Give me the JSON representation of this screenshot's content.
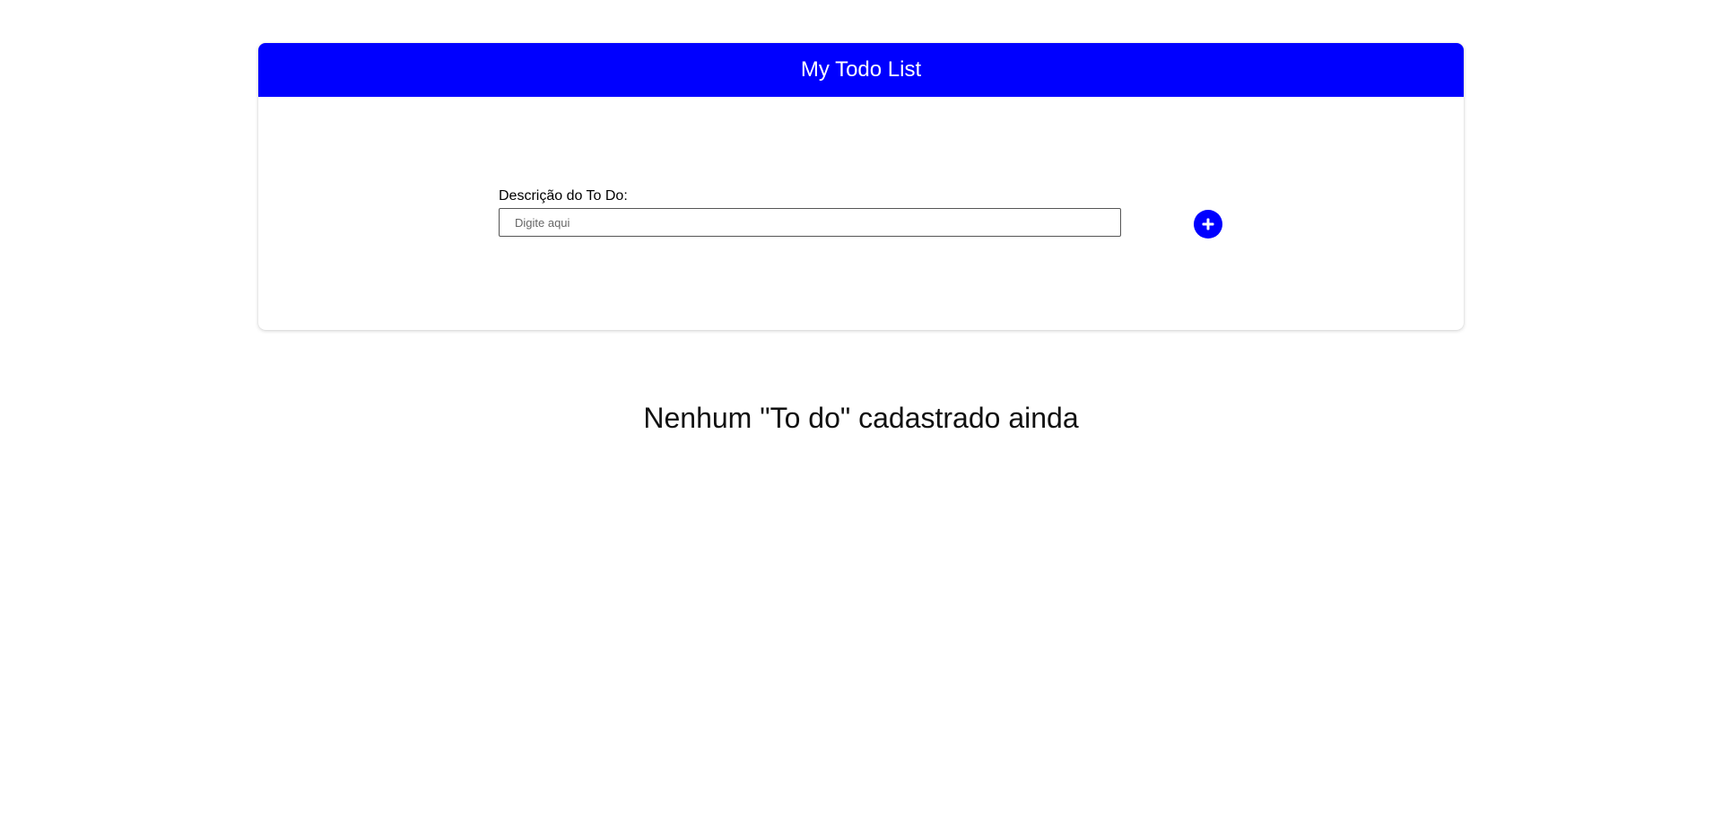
{
  "app": {
    "title": "My Todo List",
    "accent_color": "#0000ff"
  },
  "form": {
    "label": "Descrição do To Do:",
    "input_value": "",
    "input_placeholder": "Digite aqui",
    "add_button_icon": "plus-circle-icon"
  },
  "todos": {
    "items": [],
    "empty_message": "Nenhum \"To do\" cadastrado ainda"
  }
}
